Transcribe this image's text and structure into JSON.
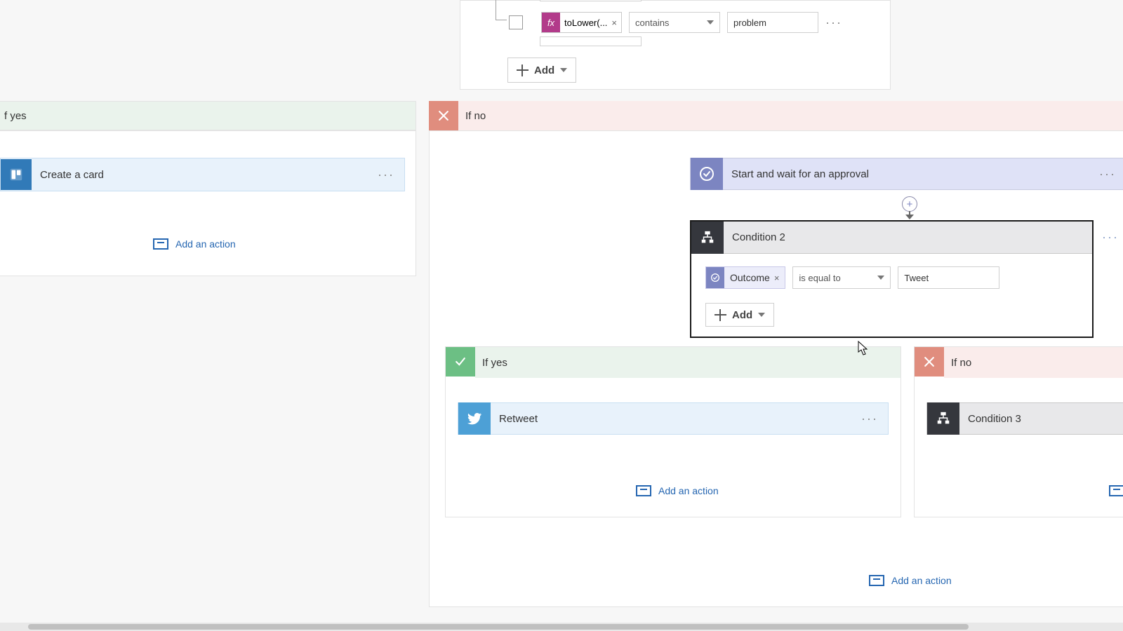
{
  "top_condition": {
    "token_label": "toLower(...",
    "operator": "contains",
    "value": "problem",
    "add_label": "Add"
  },
  "left_branch": {
    "header": "f yes",
    "card_title": "Create a card",
    "add_action": "Add an action"
  },
  "right_branch": {
    "header": "If no",
    "approval_title": "Start and wait for an approval",
    "condition2": {
      "title": "Condition 2",
      "outcome_label": "Outcome",
      "operator": "is equal to",
      "value": "Tweet",
      "add_label": "Add"
    },
    "nested_yes": {
      "header": "If yes",
      "card_title": "Retweet",
      "add_action": "Add an action"
    },
    "nested_no": {
      "header": "If no",
      "card_title": "Condition 3"
    },
    "bottom_add_action": "Add an action"
  }
}
